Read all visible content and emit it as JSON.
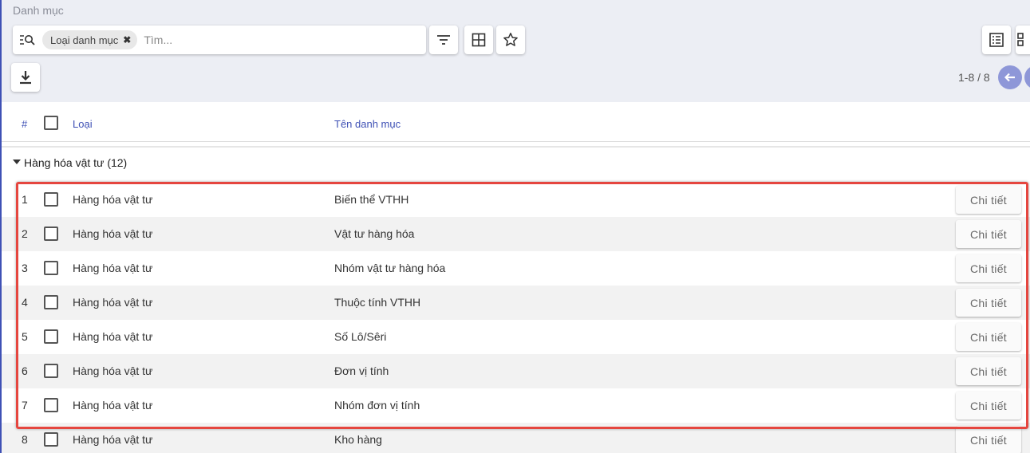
{
  "header": {
    "title": "Danh mục",
    "search": {
      "chip_label": "Loại danh mục",
      "chip_close": "✖",
      "placeholder": "Tìm..."
    },
    "pager": {
      "text": "1-8 / 8"
    }
  },
  "icons": {
    "search": "search-filter-icon",
    "filter": "filter-icon",
    "group": "group-by-icon",
    "favorite": "star-icon",
    "list_view": "list-view-icon",
    "kanban_view": "kanban-view-icon",
    "download": "download-icon",
    "prev": "arrow-left-icon"
  },
  "colors": {
    "accent": "#3f51b5",
    "highlight": "#e5463f",
    "pager": "#8e97d8"
  },
  "table": {
    "columns": {
      "index": "#",
      "type": "Loại",
      "name": "Tên danh mục"
    },
    "group": {
      "label": "Hàng hóa vật tư (12)"
    },
    "detail_label": "Chi tiết",
    "rows": [
      {
        "index": "1",
        "type": "Hàng hóa vật tư",
        "name": "Biến thể VTHH"
      },
      {
        "index": "2",
        "type": "Hàng hóa vật tư",
        "name": "Vật tư hàng hóa"
      },
      {
        "index": "3",
        "type": "Hàng hóa vật tư",
        "name": "Nhóm vật tư hàng hóa"
      },
      {
        "index": "4",
        "type": "Hàng hóa vật tư",
        "name": "Thuộc tính VTHH"
      },
      {
        "index": "5",
        "type": "Hàng hóa vật tư",
        "name": "Số Lô/Sêri"
      },
      {
        "index": "6",
        "type": "Hàng hóa vật tư",
        "name": "Đơn vị tính"
      },
      {
        "index": "7",
        "type": "Hàng hóa vật tư",
        "name": "Nhóm đơn vị tính"
      },
      {
        "index": "8",
        "type": "Hàng hóa vật tư",
        "name": "Kho hàng"
      }
    ]
  }
}
